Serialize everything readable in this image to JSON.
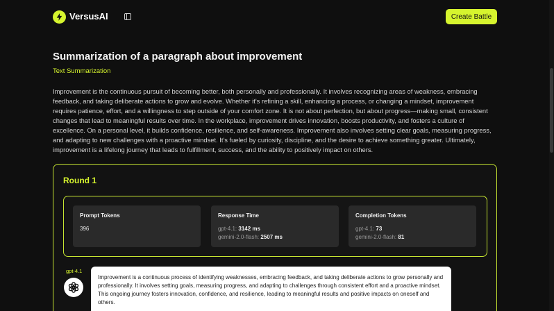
{
  "header": {
    "brand": "VersusAI",
    "logo_icon": "bolt-icon",
    "sidebar_icon": "sidebar-toggle-icon",
    "create_button": "Create Battle",
    "accent": "#d6f42e"
  },
  "battle": {
    "title": "Summarization of a paragraph about improvement",
    "category": "Text Summarization",
    "prompt": "Improvement is the continuous pursuit of becoming better, both personally and professionally. It involves recognizing areas of weakness, embracing feedback, and taking deliberate actions to grow and evolve. Whether it's refining a skill, enhancing a process, or changing a mindset, improvement requires patience, effort, and a willingness to step outside of your comfort zone. It is not about perfection, but about progress—making small, consistent changes that lead to meaningful results over time. In the workplace, improvement drives innovation, boosts productivity, and fosters a culture of excellence. On a personal level, it builds confidence, resilience, and self-awareness. Improvement also involves setting clear goals, measuring progress, and adapting to new challenges with a proactive mindset. It's fueled by curiosity, discipline, and the desire to achieve something greater. Ultimately, improvement is a lifelong journey that leads to fulfillment, success, and the ability to positively impact on others."
  },
  "round": {
    "title": "Round 1",
    "stats": {
      "prompt_tokens": {
        "label": "Prompt Tokens",
        "value": "396"
      },
      "response_time": {
        "label": "Response Time",
        "rows": [
          {
            "model": "gpt-4.1:",
            "value": "3142 ms"
          },
          {
            "model": "gemini-2.0-flash:",
            "value": "2507 ms"
          }
        ]
      },
      "completion_tokens": {
        "label": "Completion Tokens",
        "rows": [
          {
            "model": "gpt-4.1:",
            "value": "73"
          },
          {
            "model": "gemini-2.0-flash:",
            "value": "81"
          }
        ]
      }
    },
    "response": {
      "model": "gpt-4.1",
      "avatar_icon": "openai-logo-icon",
      "text": "Improvement is a continuous process of identifying weaknesses, embracing feedback, and taking deliberate actions to grow personally and professionally. It involves setting goals, measuring progress, and adapting to challenges through consistent effort and a proactive mindset. This ongoing journey fosters innovation, confidence, and resilience, leading to meaningful results and positive impacts on oneself and others."
    }
  }
}
